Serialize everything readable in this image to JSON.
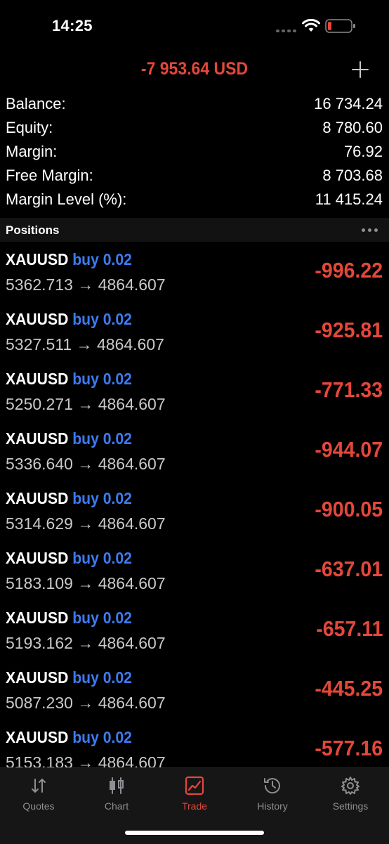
{
  "status_bar": {
    "time": "14:25",
    "battery_color": "#e5473b"
  },
  "header": {
    "total_profit": "-7 953.64 USD",
    "add_icon": "plus-icon"
  },
  "account": [
    {
      "label": "Balance:",
      "value": "16 734.24"
    },
    {
      "label": "Equity:",
      "value": "8 780.60"
    },
    {
      "label": "Margin:",
      "value": "76.92"
    },
    {
      "label": "Free Margin:",
      "value": "8 703.68"
    },
    {
      "label": "Margin Level (%):",
      "value": "11 415.24"
    }
  ],
  "positions_section": {
    "title": "Positions",
    "more_icon": "ellipsis-icon"
  },
  "positions": [
    {
      "symbol": "XAUUSD",
      "type": "buy 0.02",
      "prices": "5362.713 → 4864.607",
      "profit": "-996.22"
    },
    {
      "symbol": "XAUUSD",
      "type": "buy 0.02",
      "prices": "5327.511 → 4864.607",
      "profit": "-925.81"
    },
    {
      "symbol": "XAUUSD",
      "type": "buy 0.02",
      "prices": "5250.271 → 4864.607",
      "profit": "-771.33"
    },
    {
      "symbol": "XAUUSD",
      "type": "buy 0.02",
      "prices": "5336.640 → 4864.607",
      "profit": "-944.07"
    },
    {
      "symbol": "XAUUSD",
      "type": "buy 0.02",
      "prices": "5314.629 → 4864.607",
      "profit": "-900.05"
    },
    {
      "symbol": "XAUUSD",
      "type": "buy 0.02",
      "prices": "5183.109 → 4864.607",
      "profit": "-637.01"
    },
    {
      "symbol": "XAUUSD",
      "type": "buy 0.02",
      "prices": "5193.162 → 4864.607",
      "profit": "-657.11"
    },
    {
      "symbol": "XAUUSD",
      "type": "buy 0.02",
      "prices": "5087.230 → 4864.607",
      "profit": "-445.25"
    },
    {
      "symbol": "XAUUSD",
      "type": "buy 0.02",
      "prices": "5153.183 → 4864.607",
      "profit": "-577.16"
    }
  ],
  "tabs": [
    {
      "label": "Quotes",
      "icon": "quotes-arrows-icon"
    },
    {
      "label": "Chart",
      "icon": "candlestick-chart-icon"
    },
    {
      "label": "Trade",
      "icon": "trade-chart-icon",
      "active": true
    },
    {
      "label": "History",
      "icon": "history-clock-icon"
    },
    {
      "label": "Settings",
      "icon": "settings-gear-icon"
    }
  ],
  "colors": {
    "loss": "#e5473b",
    "buy": "#3d7bf2",
    "active_tab": "#e5473b",
    "inactive_tab": "#8e8e93"
  }
}
